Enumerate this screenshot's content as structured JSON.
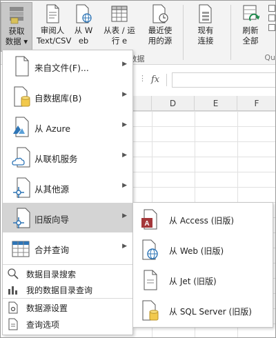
{
  "ribbon": {
    "get_data": {
      "line1": "获取",
      "line2": "数据"
    },
    "text_csv": {
      "line1": "审阅人",
      "line2": "Text/CSV"
    },
    "from_web": {
      "line1": "从 W",
      "line2": "eb"
    },
    "from_table": {
      "line1": "从表 / 运",
      "line2": "行 e"
    },
    "recent_sources": {
      "line1": "最近使",
      "line2": "用的源"
    },
    "existing_conn": {
      "line1": "现有",
      "line2": "连接"
    },
    "refresh_all": {
      "line1": "刷新",
      "line2": "全部"
    },
    "group_label": "n 数据",
    "queries_label": "Qu"
  },
  "formula_bar": {
    "fx": "fx",
    "dots": "⋮"
  },
  "columns": [
    "D",
    "E",
    "F"
  ],
  "menu": {
    "items": [
      {
        "label": "来自文件(F)...",
        "icon": "file-icon",
        "has_submenu": true
      },
      {
        "label": "自数据库(B)",
        "icon": "database-icon",
        "has_submenu": true
      },
      {
        "label": "从 Azure",
        "icon": "azure-icon",
        "has_submenu": true
      },
      {
        "label": "从联机服务",
        "icon": "cloud-icon",
        "has_submenu": true
      },
      {
        "label": "从其他源",
        "icon": "other-source-icon",
        "has_submenu": true
      },
      {
        "label": "旧版向导",
        "icon": "legacy-wizard-icon",
        "has_submenu": true,
        "highlighted": true
      },
      {
        "label": "合并查询",
        "icon": "combine-queries-icon",
        "has_submenu": true
      }
    ],
    "small_items": [
      {
        "label": "数据目录搜索",
        "icon": "catalog-search-icon"
      },
      {
        "label": "我的数据目录查询",
        "icon": "my-catalog-icon"
      },
      {
        "label": "数据源设置",
        "icon": "data-source-settings-icon"
      },
      {
        "label": "查询选项",
        "icon": "query-options-icon"
      }
    ],
    "arrow": "▶"
  },
  "submenu": {
    "items": [
      {
        "label": "从 Access (旧版)",
        "icon": "access-icon"
      },
      {
        "label": "从 Web (旧版)",
        "icon": "web-icon"
      },
      {
        "label": "从 Jet (旧版)",
        "icon": "jet-file-icon"
      },
      {
        "label": "从 SQL Server (旧版)",
        "icon": "sql-server-icon"
      }
    ]
  },
  "colors": {
    "highlight": "#d4d4d4",
    "database": "#f2c94c",
    "access": "#a4373a",
    "web": "#2e75b6"
  }
}
